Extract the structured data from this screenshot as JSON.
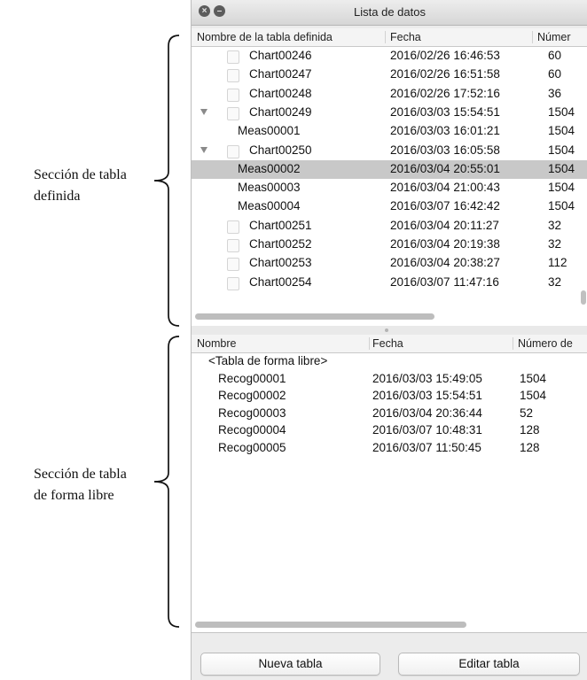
{
  "annotations": {
    "defined_section": {
      "line1": "Sección de tabla",
      "line2": "definida"
    },
    "freeform_section": {
      "line1": "Sección de tabla",
      "line2": "de forma libre"
    }
  },
  "window": {
    "title": "Lista de datos"
  },
  "defined_table": {
    "columns": [
      "Nombre de la tabla definida",
      "Fecha",
      "Númer"
    ],
    "rows": [
      {
        "name": "Chart00246",
        "date": "2016/02/26 16:46:53",
        "number": "60",
        "kind": "chart"
      },
      {
        "name": "Chart00247",
        "date": "2016/02/26 16:51:58",
        "number": "60",
        "kind": "chart"
      },
      {
        "name": "Chart00248",
        "date": "2016/02/26 17:52:16",
        "number": "36",
        "kind": "chart"
      },
      {
        "name": "Chart00249",
        "date": "2016/03/03 15:54:51",
        "number": "1504",
        "kind": "chart-expanded"
      },
      {
        "name": "Meas00001",
        "date": "2016/03/03 16:01:21",
        "number": "1504",
        "kind": "child"
      },
      {
        "name": "Chart00250",
        "date": "2016/03/03 16:05:58",
        "number": "1504",
        "kind": "chart-expanded"
      },
      {
        "name": "Meas00002",
        "date": "2016/03/04 20:55:01",
        "number": "1504",
        "kind": "child",
        "selected": true
      },
      {
        "name": "Meas00003",
        "date": "2016/03/04 21:00:43",
        "number": "1504",
        "kind": "child"
      },
      {
        "name": "Meas00004",
        "date": "2016/03/07 16:42:42",
        "number": "1504",
        "kind": "child"
      },
      {
        "name": "Chart00251",
        "date": "2016/03/04 20:11:27",
        "number": "32",
        "kind": "chart"
      },
      {
        "name": "Chart00252",
        "date": "2016/03/04 20:19:38",
        "number": "32",
        "kind": "chart"
      },
      {
        "name": "Chart00253",
        "date": "2016/03/04 20:38:27",
        "number": "112",
        "kind": "chart"
      },
      {
        "name": "Chart00254",
        "date": "2016/03/07 11:47:16",
        "number": "32",
        "kind": "chart"
      }
    ]
  },
  "freeform_table": {
    "columns": [
      "Nombre",
      "Fecha",
      "Número de"
    ],
    "rows": [
      {
        "name": "<Tabla de forma libre>",
        "date": "",
        "number": "",
        "kind": "group"
      },
      {
        "name": "Recog00001",
        "date": "2016/03/03 15:49:05",
        "number": "1504",
        "kind": "item"
      },
      {
        "name": "Recog00002",
        "date": "2016/03/03 15:54:51",
        "number": "1504",
        "kind": "item"
      },
      {
        "name": "Recog00003",
        "date": "2016/03/04 20:36:44",
        "number": "52",
        "kind": "item"
      },
      {
        "name": "Recog00004",
        "date": "2016/03/07 10:48:31",
        "number": "128",
        "kind": "item"
      },
      {
        "name": "Recog00005",
        "date": "2016/03/07 11:50:45",
        "number": "128",
        "kind": "item"
      }
    ]
  },
  "buttons": {
    "new_table": "Nueva tabla",
    "edit_table": "Editar tabla"
  }
}
